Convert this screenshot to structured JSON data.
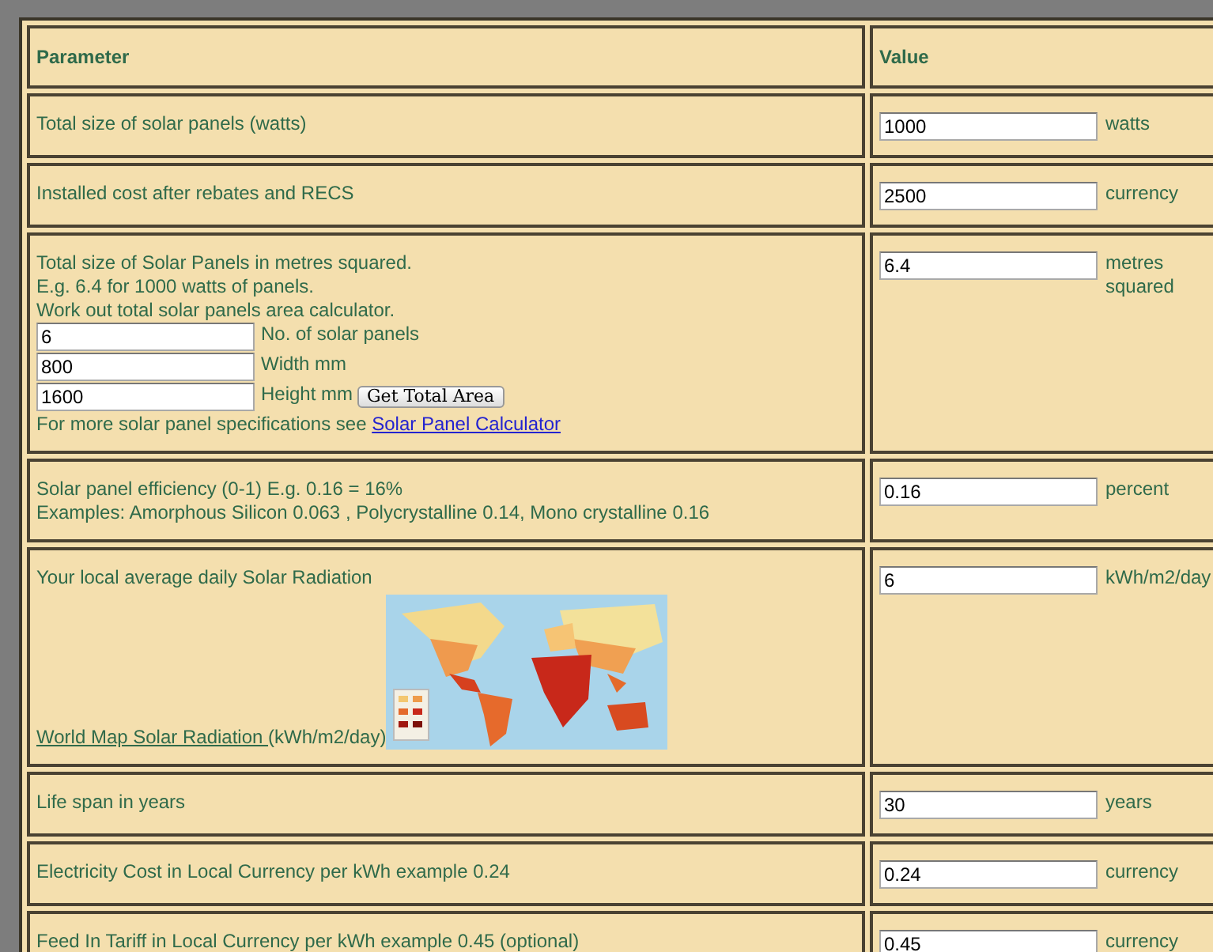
{
  "table": {
    "columns": [
      "Parameter",
      "Value"
    ],
    "rows": [
      {
        "parameter": [
          {
            "kind": "text",
            "text": "Total size of solar panels (watts)"
          }
        ],
        "value": "1000",
        "unit": "watts"
      },
      {
        "parameter": [
          {
            "kind": "text",
            "text": "Installed cost after rebates and RECS"
          }
        ],
        "value": "2500",
        "unit": "currency"
      },
      {
        "parameter": [
          {
            "kind": "text",
            "text": "Total size of Solar Panels in metres squared."
          },
          {
            "kind": "text",
            "text": "E.g. 6.4 for 1000 watts of panels."
          },
          {
            "kind": "text",
            "text": "Work out total solar panels area calculator."
          },
          {
            "kind": "field",
            "value": "6",
            "label": "No. of solar panels"
          },
          {
            "kind": "field",
            "value": "800",
            "label": "Width mm"
          },
          {
            "kind": "field",
            "value": "1600",
            "label": "Height mm",
            "button": "Get Total Area"
          },
          {
            "kind": "link",
            "text": "For more solar panel specifications see",
            "link": "Solar Panel Calculator"
          }
        ],
        "value": "6.4",
        "unit": "metres squared"
      },
      {
        "parameter": [
          {
            "kind": "text",
            "text": "Solar panel efficiency (0-1) E.g. 0.16 = 16%"
          },
          {
            "kind": "text",
            "text": "Examples: Amorphous Silicon 0.063 , Polycrystalline 0.14, Mono crystalline 0.16"
          }
        ],
        "value": "0.16",
        "unit": "percent"
      },
      {
        "parameter": [
          {
            "kind": "map",
            "text": "Your local average daily Solar Radiation",
            "link": "World Map Solar Radiation ",
            "after": "(kWh/m2/day)"
          }
        ],
        "value": "6",
        "unit": "kWh/m2/day"
      },
      {
        "parameter": [
          {
            "kind": "text",
            "text": "Life span in years"
          }
        ],
        "value": "30",
        "unit": "years"
      },
      {
        "parameter": [
          {
            "kind": "text",
            "text": "Electricity Cost in Local Currency per kWh example 0.24"
          }
        ],
        "value": "0.24",
        "unit": "currency"
      },
      {
        "parameter": [
          {
            "kind": "text",
            "text": "Feed In Tariff in Local Currency per kWh example 0.45 (optional)"
          }
        ],
        "value": "0.45",
        "unit": "currency"
      }
    ]
  }
}
